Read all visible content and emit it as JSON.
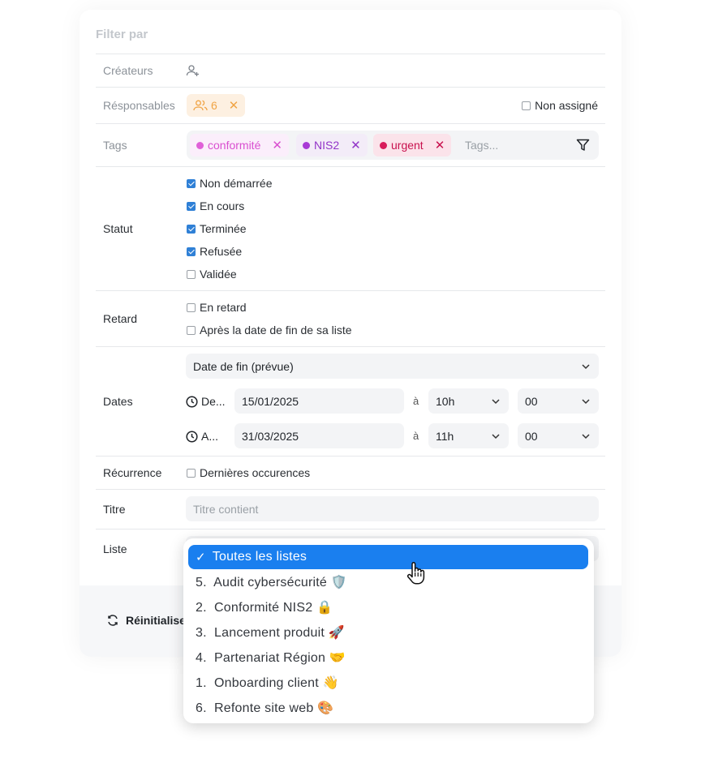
{
  "filter": {
    "title": "Filter par",
    "createurs": {
      "label": "Créateurs",
      "icon": "user-plus-icon"
    },
    "responsables": {
      "label": "Résponsables",
      "count": "6",
      "non_assigne": "Non assigné"
    },
    "tags": {
      "label": "Tags",
      "items": [
        {
          "name": "conformité",
          "color": "#e060d8",
          "bg": "#fbeefb",
          "text": "#d94fd0"
        },
        {
          "name": "NIS2",
          "color": "#a83ad6",
          "bg": "#f3ecf8",
          "text": "#9234c8"
        },
        {
          "name": "urgent",
          "color": "#d81b5a",
          "bg": "#fbe3ea",
          "text": "#c8114e"
        }
      ],
      "placeholder": "Tags..."
    },
    "statut": {
      "label": "Statut",
      "options": [
        {
          "label": "Non démarrée",
          "checked": true
        },
        {
          "label": "En cours",
          "checked": true
        },
        {
          "label": "Terminée",
          "checked": true
        },
        {
          "label": "Refusée",
          "checked": true
        },
        {
          "label": "Validée",
          "checked": false
        }
      ]
    },
    "retard": {
      "label": "Retard",
      "options": [
        {
          "label": "En retard",
          "checked": false
        },
        {
          "label": "Après la date de fin de sa liste",
          "checked": false
        }
      ]
    },
    "dates": {
      "label": "Dates",
      "type": "Date de fin (prévue)",
      "from": {
        "label": "De...",
        "date": "15/01/2025",
        "sep": "à",
        "hour": "10h",
        "minute": "00"
      },
      "to": {
        "label": "A...",
        "date": "31/03/2025",
        "sep": "à",
        "hour": "11h",
        "minute": "00"
      }
    },
    "recurrence": {
      "label": "Récurrence",
      "option": "Dernières occurences"
    },
    "titre": {
      "label": "Titre",
      "placeholder": "Titre contient"
    },
    "liste": {
      "label": "Liste"
    }
  },
  "footer": {
    "reset": "Réinitialiser"
  },
  "dropdown": {
    "items": [
      {
        "label": "Toutes les listes",
        "selected": true
      },
      {
        "label": "5.  Audit cybersécurité 🛡️",
        "selected": false
      },
      {
        "label": "2.  Conformité NIS2 🔒",
        "selected": false
      },
      {
        "label": "3.  Lancement produit 🚀",
        "selected": false
      },
      {
        "label": "4.  Partenariat Région 🤝",
        "selected": false
      },
      {
        "label": "1.  Onboarding client 👋",
        "selected": false
      },
      {
        "label": "6.  Refonte site web 🎨",
        "selected": false
      }
    ]
  },
  "colors": {
    "accent": "#1a7fef",
    "checkbox": "#2f80d6",
    "responsables_chip": "#fdf0e1"
  }
}
